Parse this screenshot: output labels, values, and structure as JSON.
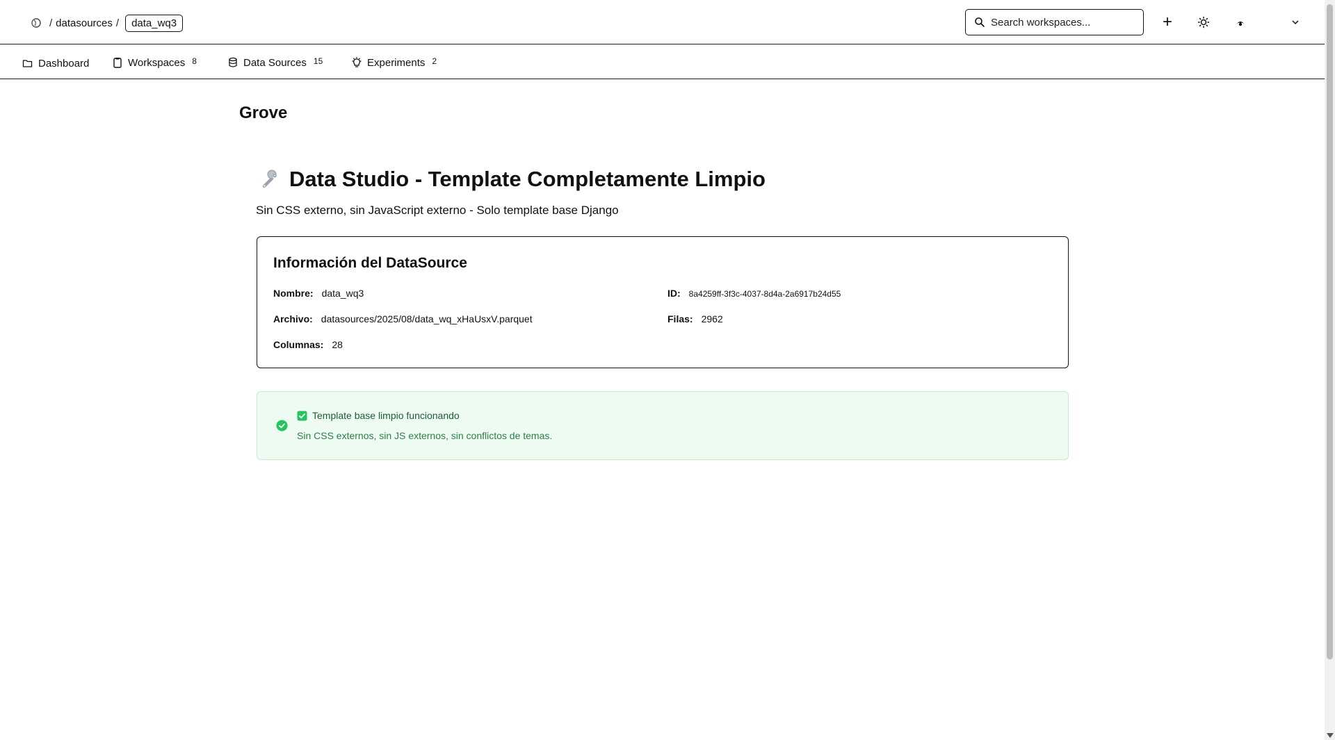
{
  "breadcrumb": {
    "home_icon": "globe-icon",
    "section": "datasources",
    "separator": "/",
    "current": "data_wq3"
  },
  "search": {
    "placeholder": "Search workspaces..."
  },
  "header_actions": {
    "add_label": "+",
    "theme_icon": "sun-icon",
    "avatar_icon": "user-avatar-icon",
    "menu_icon": "chevron-down-icon"
  },
  "nav": {
    "dashboard": {
      "label": "Dashboard",
      "icon": "folder-icon"
    },
    "workspaces": {
      "label": "Workspaces",
      "count": "8",
      "icon": "clipboard-icon"
    },
    "datasources": {
      "label": "Data Sources",
      "count": "15",
      "icon": "database-icon"
    },
    "experiments": {
      "label": "Experiments",
      "count": "2",
      "icon": "lightbulb-icon"
    }
  },
  "brand": "Grove",
  "page": {
    "title": "Data Studio - Template Completamente Limpio",
    "title_icon": "wrench-icon",
    "subtitle": "Sin CSS externo, sin JavaScript externo - Solo template base Django"
  },
  "info": {
    "heading": "Información del DataSource",
    "nombre_label": "Nombre:",
    "nombre": "data_wq3",
    "id_label": "ID:",
    "id": "8a4259ff-3f3c-4037-8d4a-2a6917b24d55",
    "archivo_label": "Archivo:",
    "archivo": "datasources/2025/08/data_wq_xHaUsxV.parquet",
    "filas_label": "Filas:",
    "filas": "2962",
    "columnas_label": "Columnas:",
    "columnas": "28"
  },
  "status": {
    "title": "Template base limpio funcionando",
    "description": "Sin CSS externos, sin JS externos, sin conflictos de temas.",
    "color": "#22c55e"
  }
}
